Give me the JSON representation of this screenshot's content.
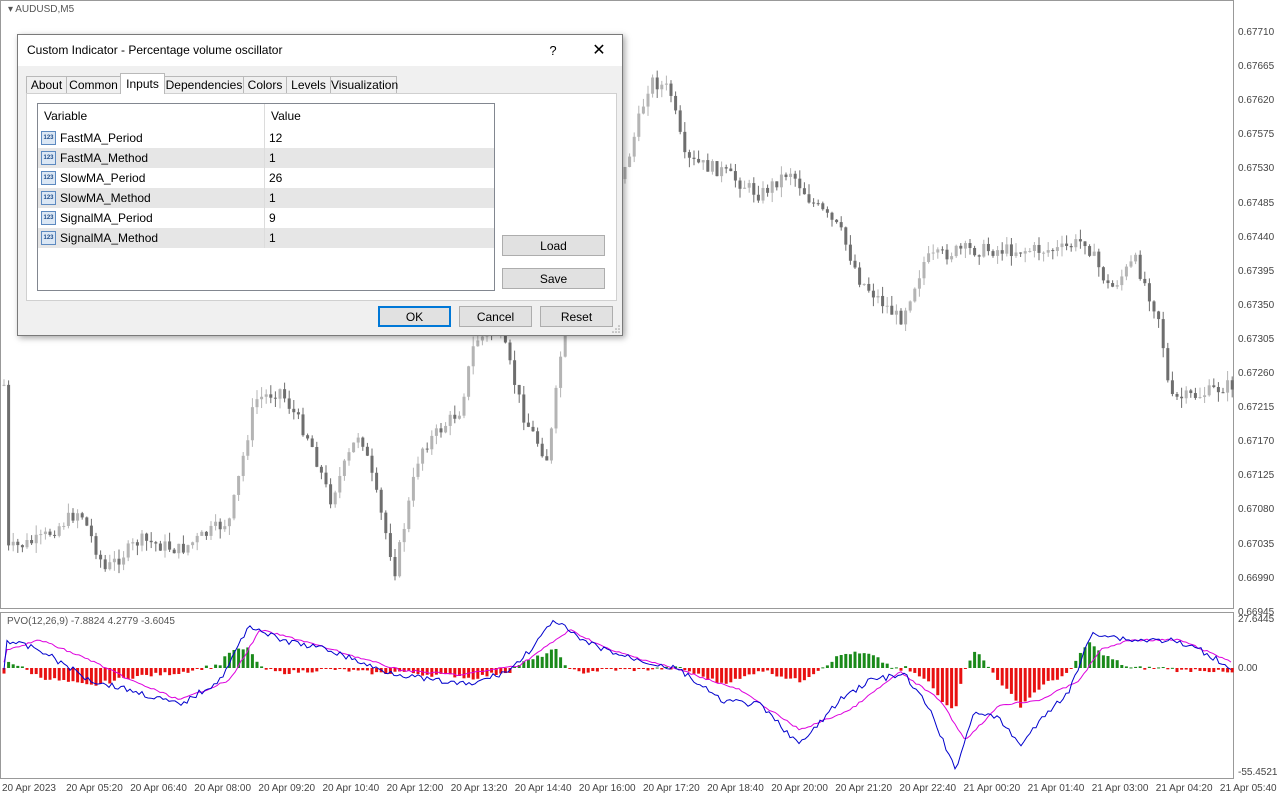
{
  "chart": {
    "symbol_label": "AUDUSD,M5",
    "price_axis_labels": [
      "0.67710",
      "0.67665",
      "0.67620",
      "0.67575",
      "0.67530",
      "0.67485",
      "0.67440",
      "0.67395",
      "0.67350",
      "0.67305",
      "0.67260",
      "0.67215",
      "0.67170",
      "0.67125",
      "0.67080",
      "0.67035",
      "0.66990",
      "0.66945"
    ],
    "time_axis_labels": [
      "20 Apr 2023",
      "20 Apr 05:20",
      "20 Apr 06:40",
      "20 Apr 08:00",
      "20 Apr 09:20",
      "20 Apr 10:40",
      "20 Apr 12:00",
      "20 Apr 13:20",
      "20 Apr 14:40",
      "20 Apr 16:00",
      "20 Apr 17:20",
      "20 Apr 18:40",
      "20 Apr 20:00",
      "20 Apr 21:20",
      "20 Apr 22:40",
      "21 Apr 00:20",
      "21 Apr 01:40",
      "21 Apr 03:00",
      "21 Apr 04:20",
      "21 Apr 05:40"
    ],
    "colors": {
      "bull_candle": "#b4b4b4",
      "bear_candle": "#6e6e6e",
      "histogram_up": "#1a8a1a",
      "histogram_down": "#e81010",
      "pvo_line": "#0000cc",
      "signal_line": "#dd00dd",
      "grid": "#c8c8c8"
    }
  },
  "indicator": {
    "label": "PVO(12,26,9) -7.8824 4.2779 -3.6045",
    "axis_labels": {
      "top": "27.6445",
      "zero": "0.00",
      "bottom": "-55.4521"
    }
  },
  "dialog": {
    "title": "Custom Indicator - Percentage volume oscillator",
    "help_label": "?",
    "close_label": "✕",
    "tabs": [
      {
        "label": "About"
      },
      {
        "label": "Common"
      },
      {
        "label": "Inputs",
        "active": true
      },
      {
        "label": "Dependencies"
      },
      {
        "label": "Colors"
      },
      {
        "label": "Levels"
      },
      {
        "label": "Visualization"
      }
    ],
    "table": {
      "headers": {
        "variable": "Variable",
        "value": "Value"
      },
      "icon_text": "123",
      "rows": [
        {
          "variable": "FastMA_Period",
          "value": "12"
        },
        {
          "variable": "FastMA_Method",
          "value": "1"
        },
        {
          "variable": "SlowMA_Period",
          "value": "26"
        },
        {
          "variable": "SlowMA_Method",
          "value": "1"
        },
        {
          "variable": "SignalMA_Period",
          "value": "9"
        },
        {
          "variable": "SignalMA_Method",
          "value": "1"
        }
      ]
    },
    "buttons": {
      "load": "Load",
      "save": "Save",
      "ok": "OK",
      "cancel": "Cancel",
      "reset": "Reset"
    }
  }
}
